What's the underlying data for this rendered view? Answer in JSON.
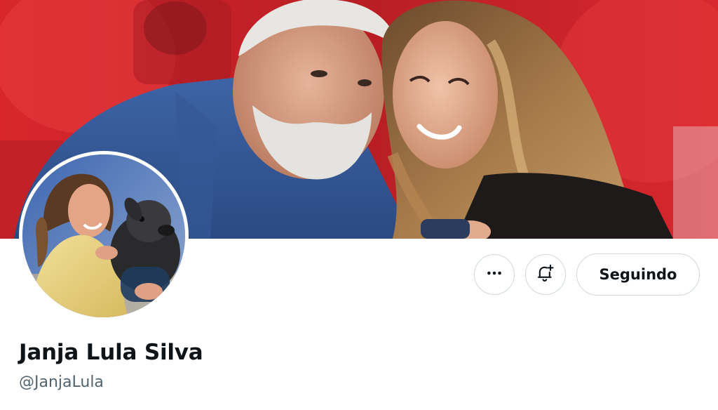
{
  "profile": {
    "display_name": "Janja Lula Silva",
    "handle": "@JanjaLula"
  },
  "actions": {
    "more_icon": "more-horizontal-icon",
    "notify_icon": "bell-plus-icon",
    "follow_label": "Seguindo"
  },
  "colors": {
    "text_primary": "#0f1419",
    "text_secondary": "#536471",
    "border": "#cfd9de",
    "banner_red": "#c8242a"
  }
}
